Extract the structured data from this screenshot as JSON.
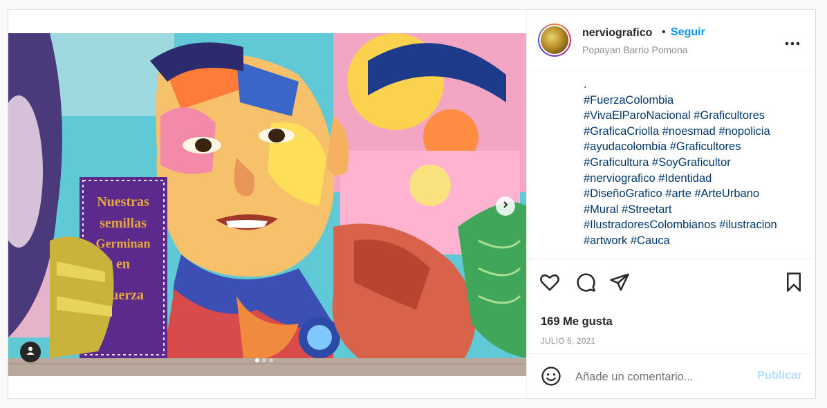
{
  "header": {
    "username": "nerviografico",
    "separator": "•",
    "follow_label": "Seguir",
    "location": "Popayan Barrio Pomona",
    "more_icon": "more-horizontal-icon"
  },
  "media": {
    "mural_text": [
      "Nuestras",
      "semillas",
      "Germinan",
      "en",
      "Fuerza"
    ],
    "carousel_count": 3,
    "carousel_active": 1
  },
  "caption": {
    "lines": [
      ".",
      "#FuerzaColombia",
      "#VivaElParoNacional #Graficultores",
      "#GraficaCriolla #noesmad #nopolicia",
      "#ayudacolombia #Graficultores",
      "#Graficultura #SoyGraficultor",
      "#nerviografico #Identidad",
      "#DiseñoGrafico #arte #ArteUrbano",
      "#Mural #Streetart",
      "#IlustradoresColombianos #ilustracion",
      "#artwork #Cauca"
    ]
  },
  "actions": {
    "like_icon": "heart-icon",
    "comment_icon": "comment-icon",
    "share_icon": "paper-plane-icon",
    "save_icon": "bookmark-icon"
  },
  "stats": {
    "likes": "169 Me gusta",
    "date": "JULIO 5, 2021"
  },
  "comment": {
    "placeholder": "Añade un comentario...",
    "publish_label": "Publicar",
    "emoji_icon": "smiley-icon"
  },
  "colors": {
    "link": "#00376b",
    "accent": "#0095f6",
    "muted": "#8e8e8e",
    "publish_disabled": "#b2dffc"
  }
}
